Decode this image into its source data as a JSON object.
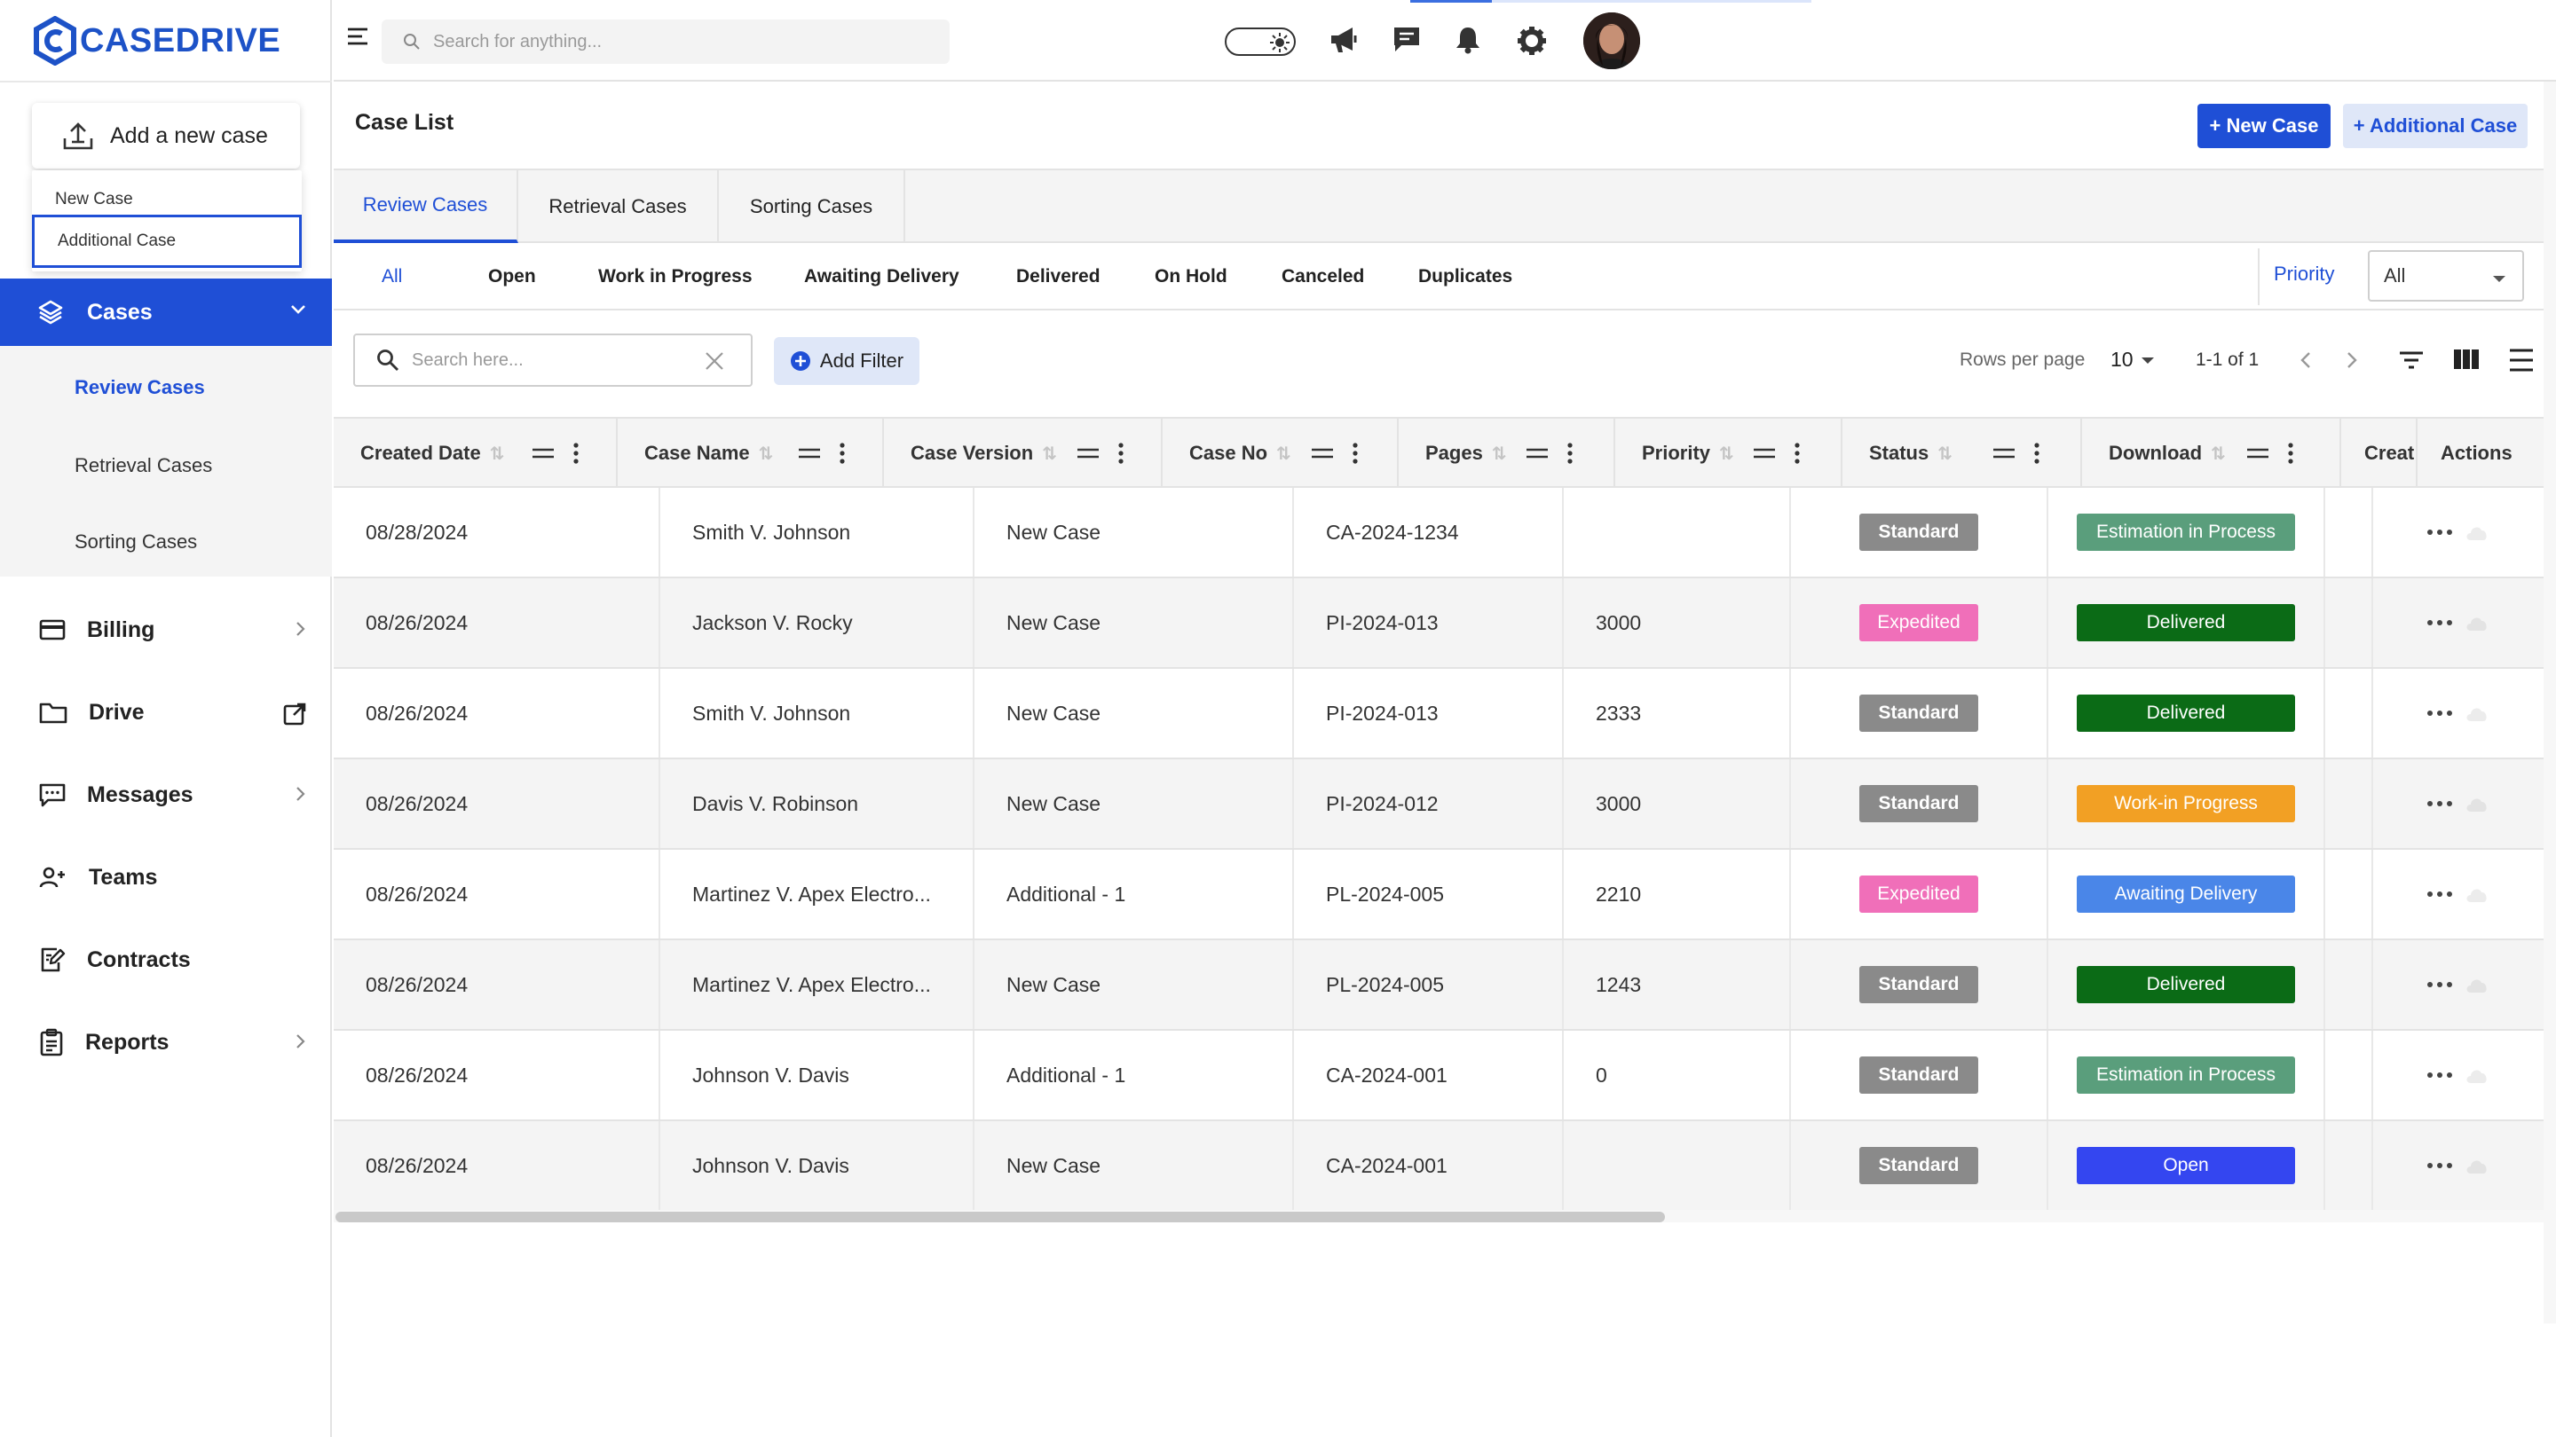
{
  "app": {
    "name": "CASEDRIVE"
  },
  "sidebar": {
    "add_button_label": "Add a new case",
    "add_menu": [
      "New Case",
      "Additional Case"
    ],
    "cases": {
      "label": "Cases",
      "subitems": [
        "Review Cases",
        "Retrieval Cases",
        "Sorting Cases"
      ]
    },
    "items": [
      {
        "label": "Billing"
      },
      {
        "label": "Drive"
      },
      {
        "label": "Messages"
      },
      {
        "label": "Teams"
      },
      {
        "label": "Contracts"
      },
      {
        "label": "Reports"
      }
    ]
  },
  "topbar": {
    "search_placeholder": "Search for anything..."
  },
  "header": {
    "title": "Case List",
    "new_case_label": "+ New Case",
    "additional_case_label": "+ Additional Case"
  },
  "tabs": [
    "Review Cases",
    "Retrieval Cases",
    "Sorting Cases"
  ],
  "status_filters": [
    "All",
    "Open",
    "Work in Progress",
    "Awaiting Delivery",
    "Delivered",
    "On Hold",
    "Canceled",
    "Duplicates"
  ],
  "priority_filter": {
    "label": "Priority",
    "value": "All"
  },
  "toolbar": {
    "search_placeholder": "Search here...",
    "add_filter_label": "Add Filter",
    "rows_per_page_label": "Rows per page",
    "rows_per_page_value": "10",
    "page_range": "1-1 of 1"
  },
  "table": {
    "columns": [
      "Created Date",
      "Case Name",
      "Case Version",
      "Case No",
      "Pages",
      "Priority",
      "Status",
      "Download",
      "Creat",
      "Actions"
    ],
    "rows": [
      {
        "date": "08/28/2024",
        "name": "Smith V. Johnson",
        "version": "New Case",
        "case_no": "CA-2024-1234",
        "pages": "",
        "priority": "Standard",
        "status": "Estimation in Process"
      },
      {
        "date": "08/26/2024",
        "name": "Jackson V. Rocky",
        "version": "New Case",
        "case_no": "PI-2024-013",
        "pages": "3000",
        "priority": "Expedited",
        "status": "Delivered"
      },
      {
        "date": "08/26/2024",
        "name": "Smith V. Johnson",
        "version": "New Case",
        "case_no": "PI-2024-013",
        "pages": "2333",
        "priority": "Standard",
        "status": "Delivered"
      },
      {
        "date": "08/26/2024",
        "name": "Davis V. Robinson",
        "version": "New Case",
        "case_no": "PI-2024-012",
        "pages": "3000",
        "priority": "Standard",
        "status": "Work-in Progress"
      },
      {
        "date": "08/26/2024",
        "name": "Martinez V. Apex Electro...",
        "version": "Additional - 1",
        "case_no": "PL-2024-005",
        "pages": "2210",
        "priority": "Expedited",
        "status": "Awaiting Delivery"
      },
      {
        "date": "08/26/2024",
        "name": "Martinez V. Apex Electro...",
        "version": "New Case",
        "case_no": "PL-2024-005",
        "pages": "1243",
        "priority": "Standard",
        "status": "Delivered"
      },
      {
        "date": "08/26/2024",
        "name": "Johnson V. Davis",
        "version": "Additional - 1",
        "case_no": "CA-2024-001",
        "pages": "0",
        "priority": "Standard",
        "status": "Estimation in Process"
      },
      {
        "date": "08/26/2024",
        "name": "Johnson V. Davis",
        "version": "New Case",
        "case_no": "CA-2024-001",
        "pages": "",
        "priority": "Standard",
        "status": "Open"
      }
    ]
  },
  "status_colors": {
    "Estimation in Process": "#5a9e7c",
    "Delivered": "#0b6b16",
    "Work-in Progress": "#f2a024",
    "Awaiting Delivery": "#4a86e8",
    "Open": "#3446f0"
  },
  "colors": {
    "accent": "#1f4fd6",
    "standard": "#8a8a8a",
    "expedited": "#f06fb9"
  }
}
